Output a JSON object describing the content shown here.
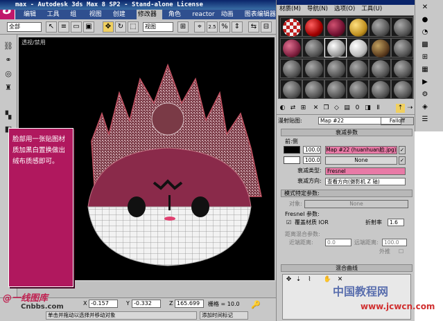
{
  "app": {
    "logo": "8",
    "title": "max - Autodesk 3ds Max 8 SP2 - Stand-alone License"
  },
  "menu": [
    "编辑(E)",
    "工具(T)",
    "组(G)",
    "视图(V)",
    "创建(C)",
    "修改器(O)",
    "角色(H)",
    "reactor",
    "动画(A)",
    "图表编辑器(D)"
  ],
  "toolbar": {
    "selection_filter": "全部",
    "coord_system": "视图",
    "angle_snap": "2.5"
  },
  "viewport": {
    "label": "透视/禁用",
    "note": "脸部用一张贴图材质加黑白置换做出绒布质感即可。"
  },
  "status": {
    "x_label": "X",
    "x": "-0.157",
    "y_label": "Y",
    "y": "-0.332",
    "z_label": "Z",
    "z": "165.699",
    "grid": "栅格 = 10.0",
    "prompt": "单击并拖动以选择并移动对象",
    "add_tag": "添加时间标记"
  },
  "watermarks": {
    "left_brand": "@一线图库",
    "left_url": "Cnbbs.com",
    "right_brand": "中国教程网",
    "right_url": "www.jcwcn.com"
  },
  "material_editor": {
    "menu": [
      "材质(M)",
      "导航(N)",
      "选项(O)",
      "工具(U)"
    ],
    "map_label": "漫射贴图:",
    "map_name": "Map #22",
    "map_type": "Falloff",
    "falloff_rollout": "衰减参数",
    "front_side": "前:侧",
    "front_value": "100.0",
    "front_map": "Map #22 (huanhuan脸.jpg)",
    "side_value": "100.0",
    "side_map": "None",
    "falloff_type_label": "衰减类型:",
    "falloff_type": "Fresnel",
    "falloff_dir_label": "衰减方向:",
    "falloff_dir": "查看方向(摄影机 Z 轴)",
    "mode_rollout": "模式特定参数:",
    "object_label": "对象:",
    "object_value": "None",
    "fresnel_label": "Fresnel 参数:",
    "override_ior": "覆盖材质 IOR",
    "ior_label": "折射率",
    "ior_value": "1.6",
    "distance_label": "距离混合参数:",
    "near_label": "近端距离:",
    "near_value": "0.0",
    "far_label": "远端距离:",
    "far_value": "100.0",
    "extrapolate": "外推",
    "curve_rollout": "混合曲线"
  },
  "colors": {
    "accent": "#c0186b",
    "titlebar": "#0a246a",
    "pink_field": "#e87aa6"
  }
}
